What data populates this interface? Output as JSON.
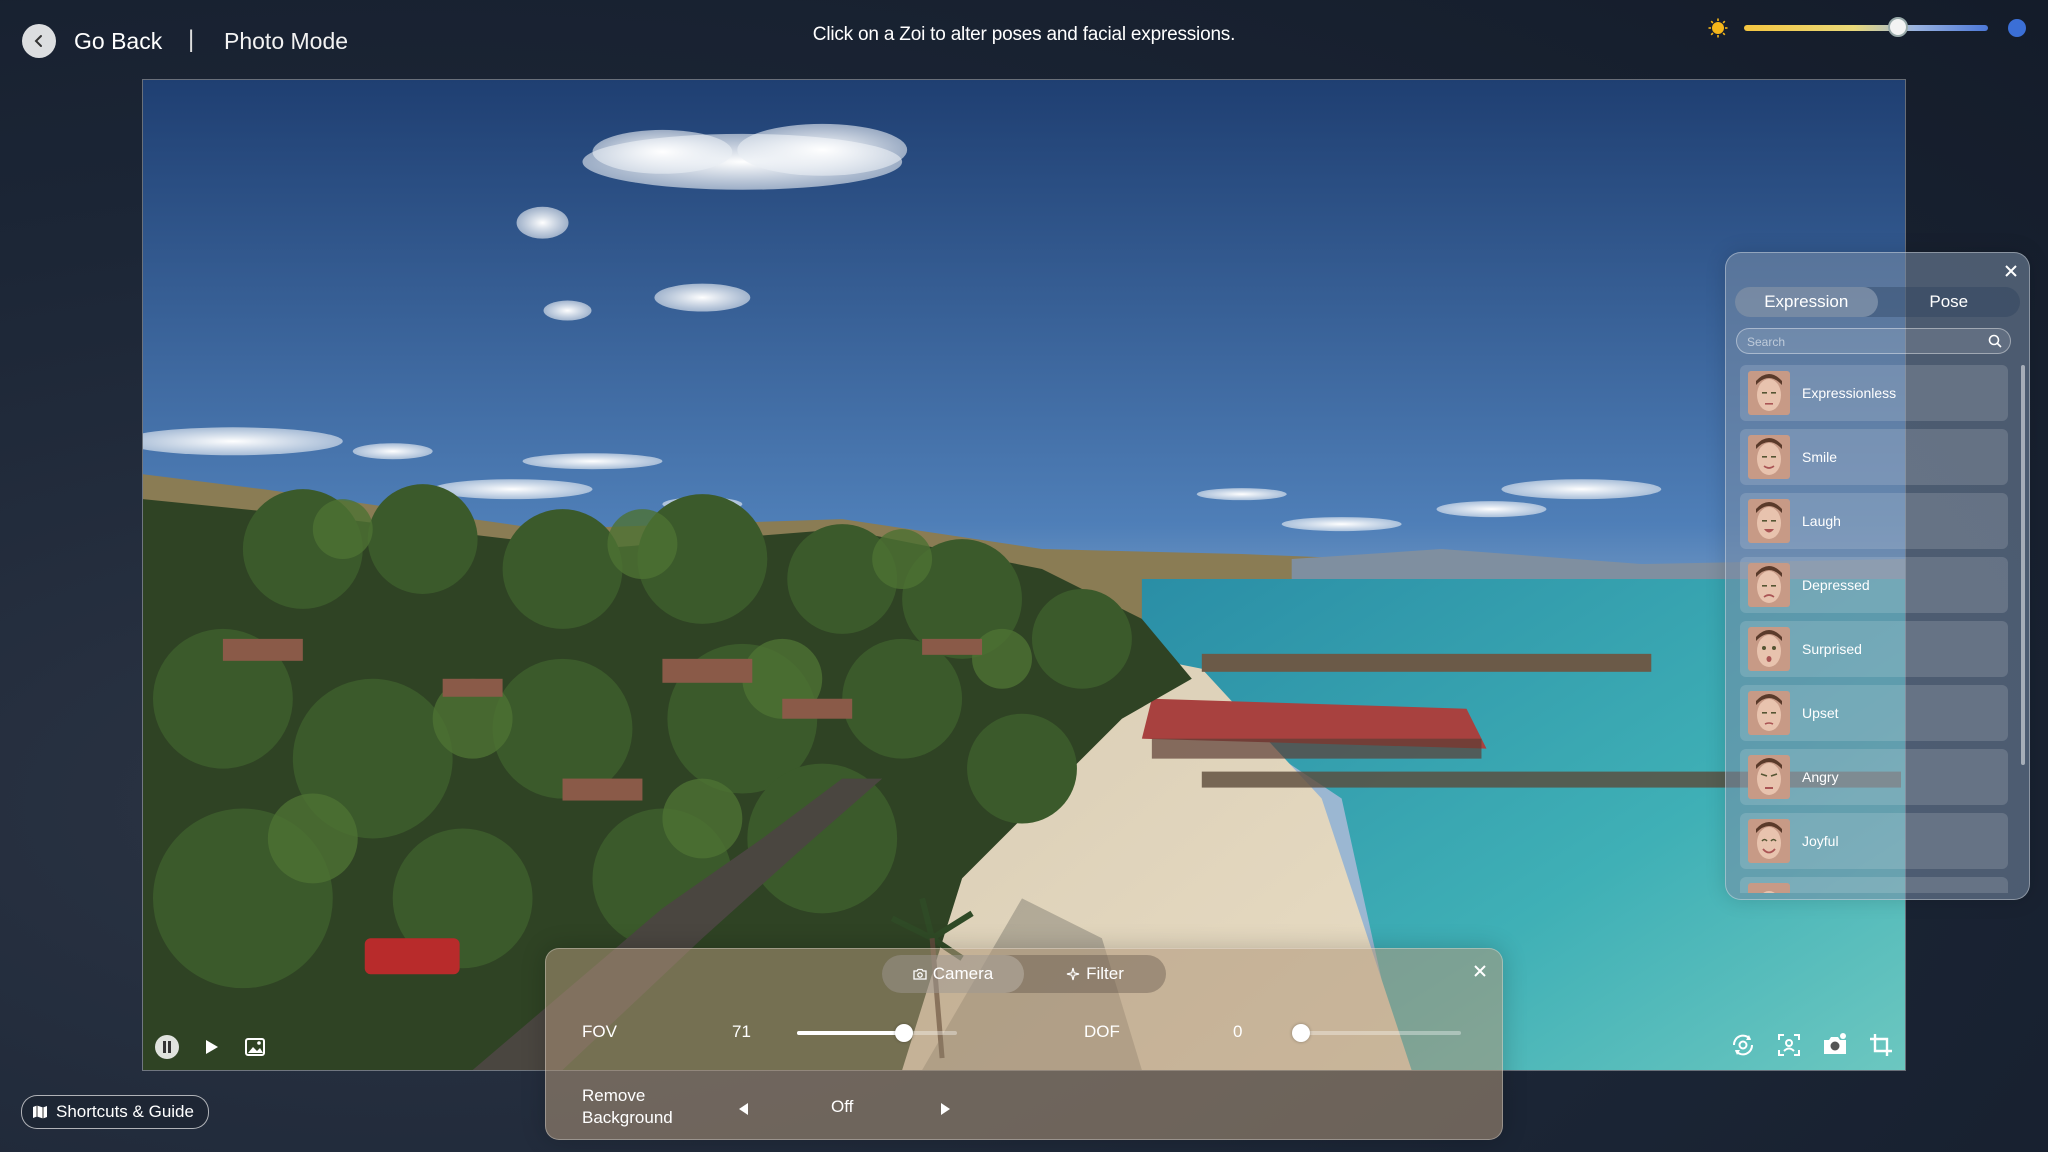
{
  "header": {
    "back_label": "Go Back",
    "separator": "|",
    "mode_title": "Photo Mode",
    "hint": "Click on a Zoi to alter poses and facial expressions."
  },
  "time_of_day": {
    "level": 0.63,
    "start_icon": "sun-icon",
    "end_icon": "moon-icon"
  },
  "expression_panel": {
    "tabs": [
      {
        "label": "Expression",
        "active": true
      },
      {
        "label": "Pose",
        "active": false
      }
    ],
    "search_placeholder": "Search",
    "items": [
      {
        "label": "Expressionless"
      },
      {
        "label": "Smile"
      },
      {
        "label": "Laugh"
      },
      {
        "label": "Depressed"
      },
      {
        "label": "Surprised"
      },
      {
        "label": "Upset"
      },
      {
        "label": "Angry"
      },
      {
        "label": "Joyful"
      }
    ]
  },
  "camera_panel": {
    "tabs": [
      {
        "label": "Camera",
        "icon": "camera-icon",
        "active": true
      },
      {
        "label": "Filter",
        "icon": "sparkle-icon",
        "active": false
      }
    ],
    "fov": {
      "label": "FOV",
      "value": "71",
      "level": 0.67
    },
    "dof": {
      "label": "DOF",
      "value": "0",
      "level": 0.0
    },
    "remove_background": {
      "label_line1": "Remove",
      "label_line2": "Background",
      "value": "Off"
    }
  },
  "playback_controls": [
    "pause-icon",
    "play-icon",
    "gallery-icon"
  ],
  "tool_controls": [
    "rotate-camera-icon",
    "focus-frame-icon",
    "screenshot-icon",
    "crop-icon"
  ],
  "footer": {
    "shortcuts_label": "Shortcuts & Guide"
  }
}
